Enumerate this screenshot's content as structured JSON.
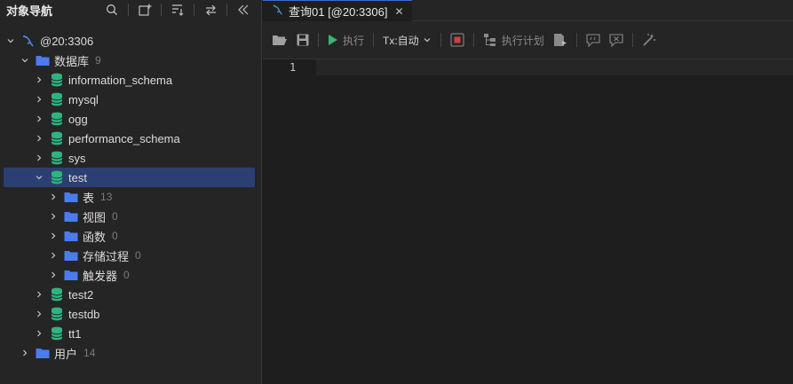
{
  "left_panel": {
    "title": "对象导航",
    "header_icons": [
      "search-icon",
      "add-window-icon",
      "sort-icon",
      "sync-icon",
      "collapse-icon"
    ]
  },
  "tree": {
    "connection": {
      "label": "@20:3306"
    },
    "databases": {
      "label": "数据库",
      "count": "9"
    },
    "db_items": [
      {
        "label": "information_schema"
      },
      {
        "label": "mysql"
      },
      {
        "label": "ogg"
      },
      {
        "label": "performance_schema"
      },
      {
        "label": "sys"
      },
      {
        "label": "test"
      }
    ],
    "test_children": [
      {
        "label": "表",
        "count": "13"
      },
      {
        "label": "视图",
        "count": "0"
      },
      {
        "label": "函数",
        "count": "0"
      },
      {
        "label": "存储过程",
        "count": "0"
      },
      {
        "label": "触发器",
        "count": "0"
      }
    ],
    "db_items_after": [
      {
        "label": "test2"
      },
      {
        "label": "testdb"
      },
      {
        "label": "tt1"
      }
    ],
    "users": {
      "label": "用户",
      "count": "14"
    }
  },
  "tab": {
    "label": "查询01 [@20:3306]",
    "close": "✕"
  },
  "toolbar": {
    "execute_label": "执行",
    "tx_label": "Tx:自动",
    "explain_label": "执行计划"
  },
  "editor": {
    "line_number": "1"
  },
  "colors": {
    "db_icon": "#2fb37f",
    "folder_icon": "#4a7cf0",
    "selected_row": "#2b3f73",
    "run_green": "#3cb371",
    "stop_red": "#d04040"
  }
}
